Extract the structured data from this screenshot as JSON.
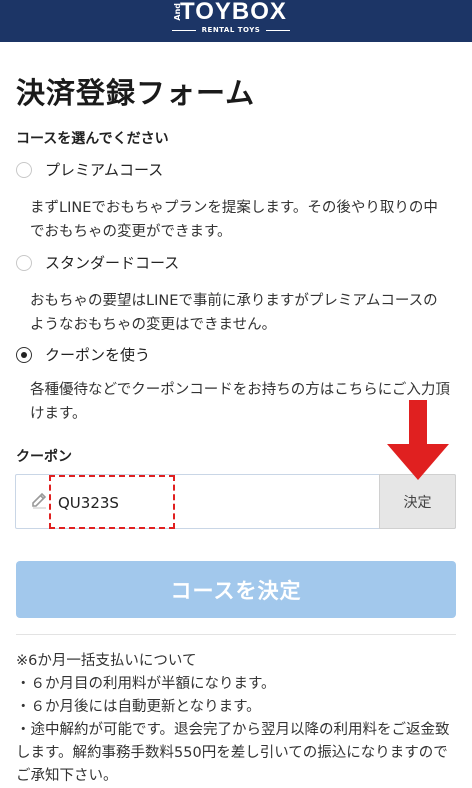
{
  "header": {
    "logo_and": "And",
    "logo_text": "TOYBOX",
    "logo_sub": "RENTAL TOYS",
    "bg_color": "#1c3566"
  },
  "page_title": "決済登録フォーム",
  "course_prompt": "コースを選んでください",
  "options": [
    {
      "label": "プレミアムコース",
      "selected": false,
      "description": "まずLINEでおもちゃプランを提案します。その後やり取りの中でおもちゃの変更ができます。"
    },
    {
      "label": "スタンダードコース",
      "selected": false,
      "description": "おもちゃの要望はLINEで事前に承りますがプレミアムコースのようなおもちゃの変更はできません。"
    },
    {
      "label": "クーポンを使う",
      "selected": true,
      "description": "各種優待などでクーポンコードをお持ちの方はこちらにご入力頂けます。"
    }
  ],
  "coupon": {
    "label": "クーポン",
    "value": "QU323S",
    "apply_label": "決定"
  },
  "submit_label": "コースを決定",
  "notes": [
    "※6か月一括支払いについて",
    "・６か月目の利用料が半額になります。",
    "・６か月後には自動更新となります。",
    "・途中解約が可能です。退会完了から翌月以降の利用料をご返金致します。解約事務手数料550円を差し引いての振込になりますのでご承知下さい。"
  ],
  "colors": {
    "accent": "#1c3566",
    "submit_disabled": "#a2c8ec",
    "annotation": "#e02020"
  }
}
